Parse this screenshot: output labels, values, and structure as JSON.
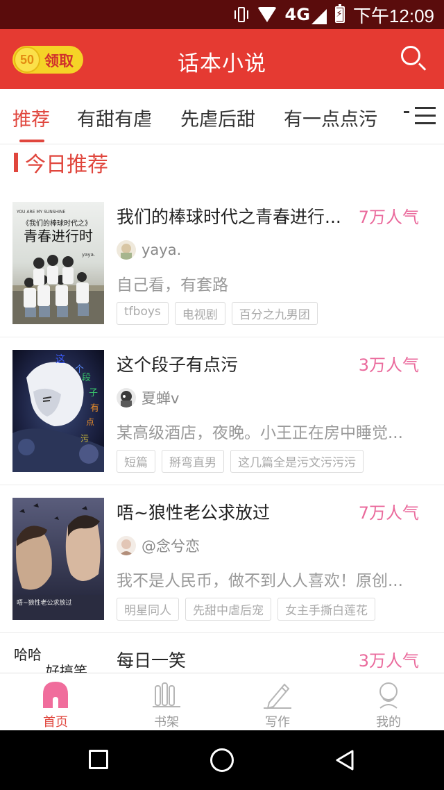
{
  "status_bar": {
    "network": "4G",
    "time": "下午12:09"
  },
  "header": {
    "coins": "50",
    "claim_label": "领取",
    "title": "话本小说"
  },
  "tabs": [
    {
      "label": "推荐"
    },
    {
      "label": "有甜有虐"
    },
    {
      "label": "先虐后甜"
    },
    {
      "label": "有一点点污"
    }
  ],
  "section": {
    "title": "今日推荐"
  },
  "books": [
    {
      "title": "我们的棒球时代之青春进行...",
      "popularity": "7万人气",
      "author": "yaya.",
      "summary": "自己看，有套路",
      "tags": [
        "tfboys",
        "电视剧",
        "百分之九男团"
      ],
      "cover_text": [
        "YOU ARE MY SUNSHINE",
        "《我们的棒球时代之》",
        "青春进行时",
        "yaya."
      ]
    },
    {
      "title": "这个段子有点污",
      "popularity": "3万人气",
      "author": "夏蝉v",
      "summary": "某高级酒店，夜晚。小王正在房中睡觉...",
      "tags": [
        "短篇",
        "掰弯直男",
        "这几篇全是污文污污污"
      ],
      "cover_text": [
        "这",
        "个",
        "段",
        "子",
        "有",
        "点",
        "污"
      ]
    },
    {
      "title": "唔~狼性老公求放过",
      "popularity": "7万人气",
      "author": "@念兮恋",
      "summary": "我不是人民币，做不到人人喜欢！原创...",
      "tags": [
        "明星同人",
        "先甜中虐后宠",
        "女主手撕白莲花"
      ],
      "cover_text": [
        "唔~狼性老公求放过"
      ]
    },
    {
      "title": "每日一笑",
      "popularity": "3万人气",
      "cover_text": [
        "哈哈",
        "好搞笑"
      ]
    }
  ],
  "bottom_nav": [
    {
      "label": "首页"
    },
    {
      "label": "书架"
    },
    {
      "label": "写作"
    },
    {
      "label": "我的"
    }
  ],
  "colors": {
    "accent": "#e53a32",
    "popularity": "#ea6a9c",
    "status_bar": "#5a0c0c"
  }
}
